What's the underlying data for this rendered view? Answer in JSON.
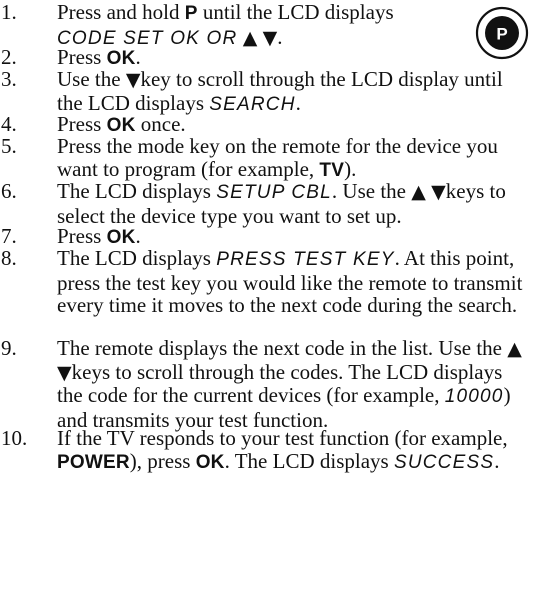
{
  "badge": {
    "letter": "P"
  },
  "arrow_glyphs": {
    "up": "▲",
    "down": "▼"
  },
  "steps": [
    {
      "num": "1.",
      "a": "Press and hold ",
      "b": "P",
      "c": " until the LCD displays",
      "lcd": "CODE SET OK OR",
      "end": "."
    },
    {
      "num": "2.",
      "a": "Press ",
      "b": "OK",
      "c": "."
    },
    {
      "num": "3.",
      "a": "Use the ",
      "c": "key to scroll through the LCD display until the LCD displays ",
      "lcd": "SEARCH",
      "end": "."
    },
    {
      "num": "4.",
      "a": "Press ",
      "b": "OK",
      "c": " once."
    },
    {
      "num": "5.",
      "a": "Press the mode key on the remote for the device you want to program (for example, ",
      "b": "TV",
      "c": ")."
    },
    {
      "num": "6.",
      "a": "The LCD displays ",
      "lcd": "SETUP CBL",
      "c": ". Use the ",
      "d": "keys to select the device type you want to set up."
    },
    {
      "num": "7.",
      "a": "Press ",
      "b": "OK",
      "c": "."
    },
    {
      "num": "8.",
      "a": "The LCD displays ",
      "lcd": "PRESS TEST KEY",
      "c": ". At this point, press the test key you would like the remote to transmit every time it moves to the next code during the search."
    },
    {
      "num": "9.",
      "a": "The remote displays the next code in the list. Use the ",
      "c": "keys to scroll through the codes. The LCD displays the code for the current devices (for example, ",
      "lcd": "10000",
      "d": ") and transmits your test function."
    },
    {
      "num": "10.",
      "a": "If the TV responds to your test function (for example, ",
      "b": "POWER",
      "c": "), press ",
      "b2": "OK",
      "d": ". The LCD displays ",
      "lcd": "SUCCESS",
      "end": "."
    }
  ]
}
